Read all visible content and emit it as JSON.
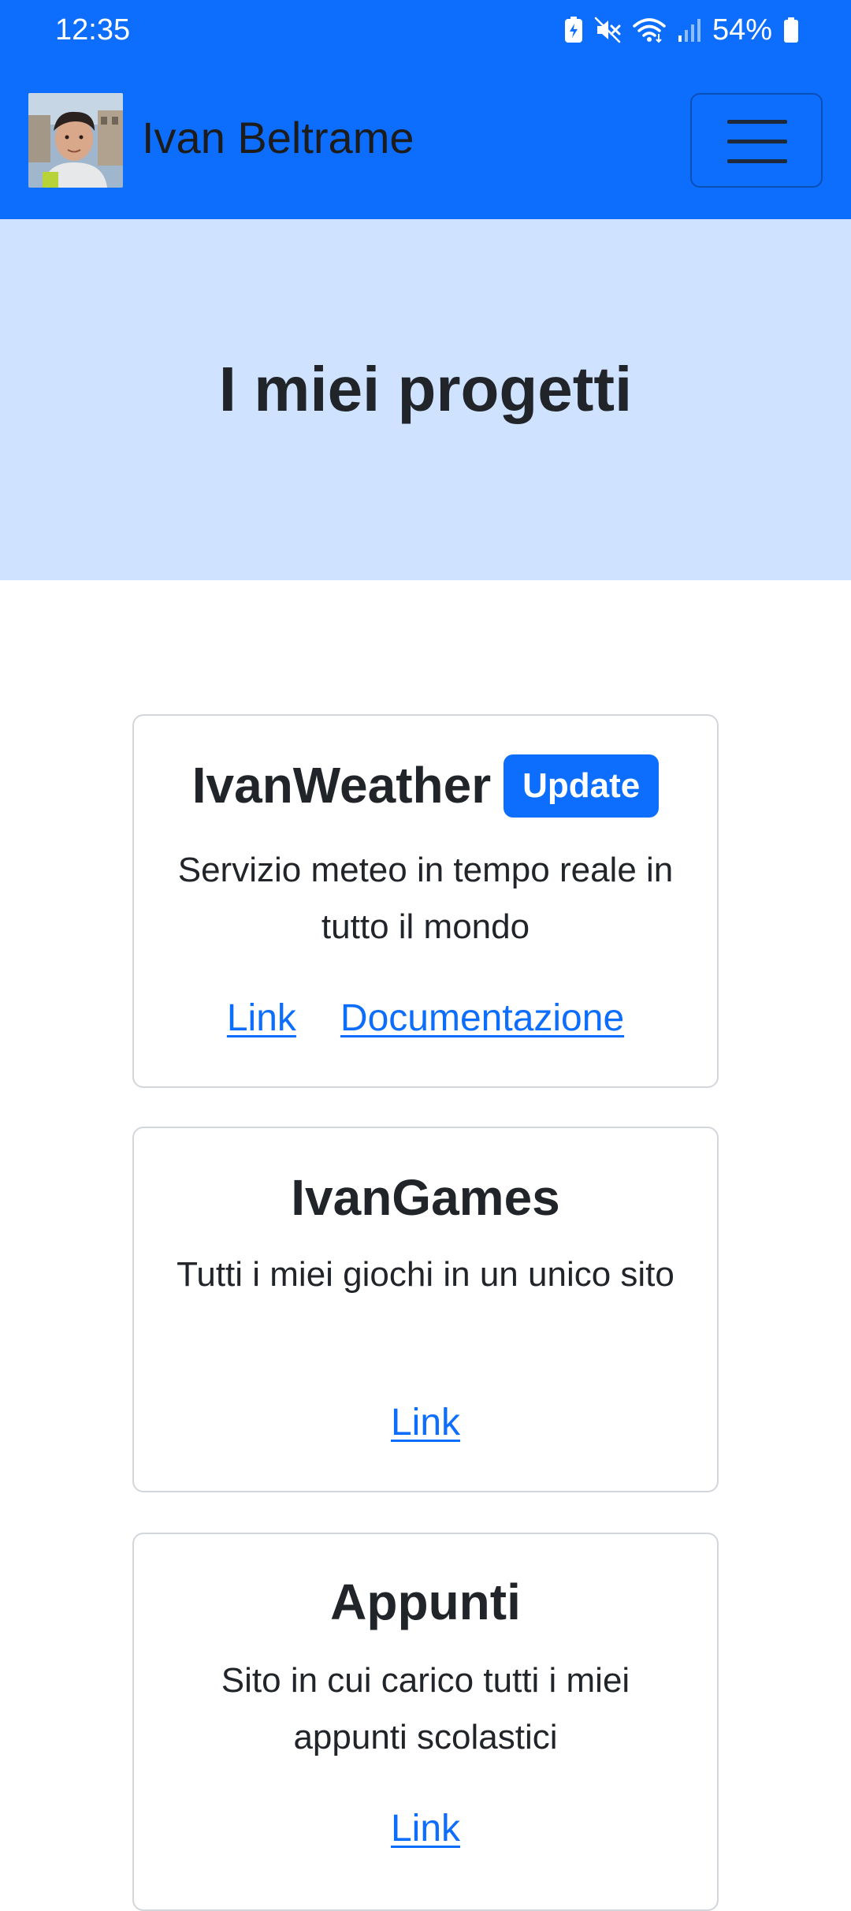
{
  "status_bar": {
    "time": "12:35",
    "battery": "54%",
    "icons": [
      "battery-saver-icon",
      "mute-icon",
      "wifi-icon",
      "signal-icon",
      "battery-icon"
    ]
  },
  "navbar": {
    "brand_name": "Ivan Beltrame",
    "avatar_icon": "profile-photo",
    "menu_icon": "hamburger-menu-icon"
  },
  "hero": {
    "title": "I miei progetti"
  },
  "colors": {
    "primary": "#0d6efd",
    "hero_bg": "#cfe2ff",
    "card_border": "#d3d6da"
  },
  "projects": [
    {
      "title": "IvanWeather",
      "badge": "Update",
      "description": "Servizio meteo in tempo reale in tutto il mondo",
      "links": [
        "Link",
        "Documentazione"
      ]
    },
    {
      "title": "IvanGames",
      "description": "Tutti i miei giochi in un unico sito",
      "links": [
        "Link"
      ]
    },
    {
      "title": "Appunti",
      "description": "Sito in cui carico tutti i miei appunti scolastici",
      "links": [
        "Link"
      ]
    }
  ]
}
